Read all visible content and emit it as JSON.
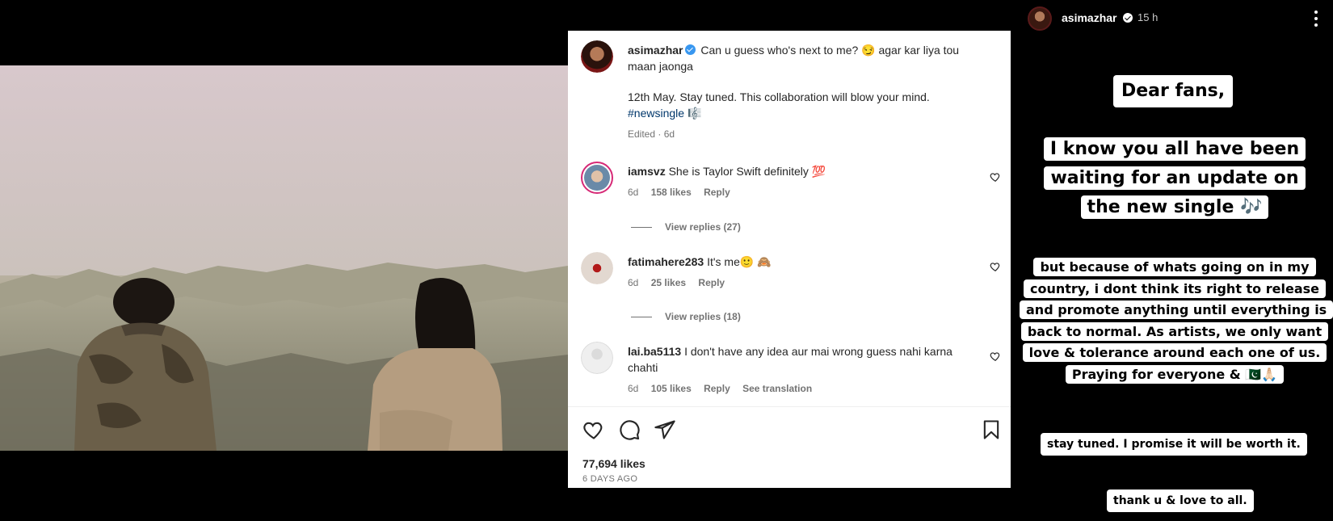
{
  "post": {
    "author": "asimazhar",
    "caption_line1": "Can u guess who's next to me? 😏 agar kar liya tou maan jaonga",
    "caption_line2": "12th May. Stay tuned. This collaboration will blow your mind.",
    "hashtag": "#newsingle",
    "hashtag_emoji": "🎼",
    "edited_label": "Edited · 6d",
    "likes_total": "77,694 likes",
    "date": "6 DAYS AGO"
  },
  "comments": [
    {
      "user": "iamsvz",
      "text": "She is Taylor Swift definitely 💯",
      "age": "6d",
      "likes": "158 likes",
      "reply": "Reply",
      "view_replies": "View replies (27)"
    },
    {
      "user": "fatimahere283",
      "text": "It's me🙂 🙈",
      "age": "6d",
      "likes": "25 likes",
      "reply": "Reply",
      "view_replies": "View replies (18)"
    },
    {
      "user": "lai.ba5113",
      "text": "I don't have any idea aur mai wrong guess nahi karna chahti",
      "age": "6d",
      "likes": "105 likes",
      "reply": "Reply",
      "see_translation": "See translation"
    }
  ],
  "story": {
    "user": "asimazhar",
    "time": "15 h",
    "sticker1": "Dear fans,",
    "sticker2": "I know you all have been waiting for an update on the new single 🎶",
    "sticker3": "but because of whats going on in my country, i dont think its right to release and promote anything until everything is back to normal. As artists, we only want love & tolerance around each one of us. Praying for everyone & 🇵🇰🙏🏻",
    "sticker4": "stay tuned. I promise it will be worth it.",
    "sticker5": "thank u & love to all."
  },
  "icons": [
    "heart-icon",
    "comment-icon",
    "share-icon",
    "bookmark-icon",
    "more-options-icon",
    "verified-badge-icon"
  ],
  "colors": {
    "verified_blue": "#3897f0",
    "hashtag_blue": "#00376b",
    "meta_gray": "#737373",
    "story_ring": "#d62976"
  }
}
